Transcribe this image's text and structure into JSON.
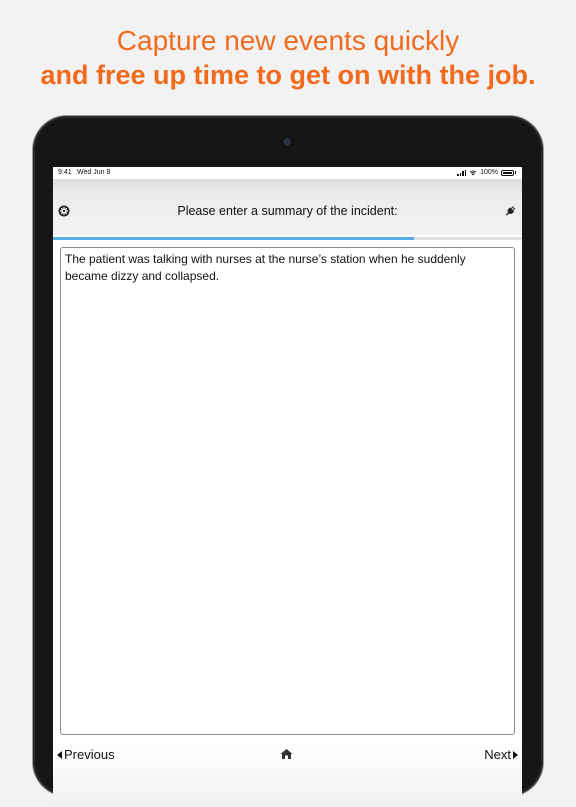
{
  "headline": {
    "line1": "Capture new events quickly",
    "line2": "and free up time to get on with the job."
  },
  "status_bar": {
    "time": "9:41",
    "date": "Wed Jun 8",
    "battery": "100%"
  },
  "form": {
    "prompt": "Please enter a summary of the incident:",
    "progress_fraction": 0.77,
    "summary_text": "The patient was talking with nurses at the nurse’s station when he suddenly became dizzy and collapsed."
  },
  "footer": {
    "previous_label": "Previous",
    "next_label": "Next"
  },
  "icons": {
    "settings": "gear-icon",
    "connection": "plug-icon",
    "home": "home-icon",
    "previous": "caret-left-icon",
    "next": "caret-right-icon"
  },
  "colors": {
    "headline": "#f06b1d",
    "progress": "#5aaee8",
    "device_bezel": "#161616"
  }
}
